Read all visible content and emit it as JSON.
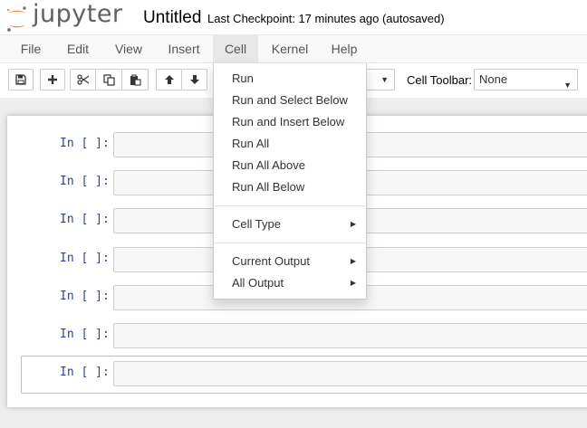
{
  "app": {
    "logo_text": "jupyter",
    "notebook_name": "Untitled",
    "checkpoint": "Last Checkpoint: 17 minutes ago (autosaved)"
  },
  "menubar": {
    "items": [
      {
        "label": "File"
      },
      {
        "label": "Edit"
      },
      {
        "label": "View"
      },
      {
        "label": "Insert"
      },
      {
        "label": "Cell",
        "open": true
      },
      {
        "label": "Kernel"
      },
      {
        "label": "Help"
      }
    ]
  },
  "toolbar": {
    "buttons": [
      {
        "icon": "save-icon"
      },
      {
        "icon": "plus-icon"
      },
      {
        "icon": "cut-icon"
      },
      {
        "icon": "copy-icon"
      },
      {
        "icon": "paste-icon"
      },
      {
        "icon": "arrow-up-icon"
      },
      {
        "icon": "arrow-down-icon"
      }
    ],
    "cell_toolbar_label": "Cell Toolbar:",
    "cell_toolbar_value": "None"
  },
  "cell_menu": {
    "group1": [
      "Run",
      "Run and Select Below",
      "Run and Insert Below",
      "Run All",
      "Run All Above",
      "Run All Below"
    ],
    "group2": [
      "Cell Type"
    ],
    "group3": [
      "Current Output",
      "All Output"
    ]
  },
  "cells": [
    {
      "prompt": "In [ ]:"
    },
    {
      "prompt": "In [ ]:"
    },
    {
      "prompt": "In [ ]:"
    },
    {
      "prompt": "In [ ]:"
    },
    {
      "prompt": "In [ ]:"
    },
    {
      "prompt": "In [ ]:"
    },
    {
      "prompt": "In [ ]:",
      "selected": true
    }
  ],
  "colors": {
    "logo_orange": "#f37726",
    "prompt_blue": "#303f9f",
    "menu_open_bg": "#e7e7e7"
  }
}
